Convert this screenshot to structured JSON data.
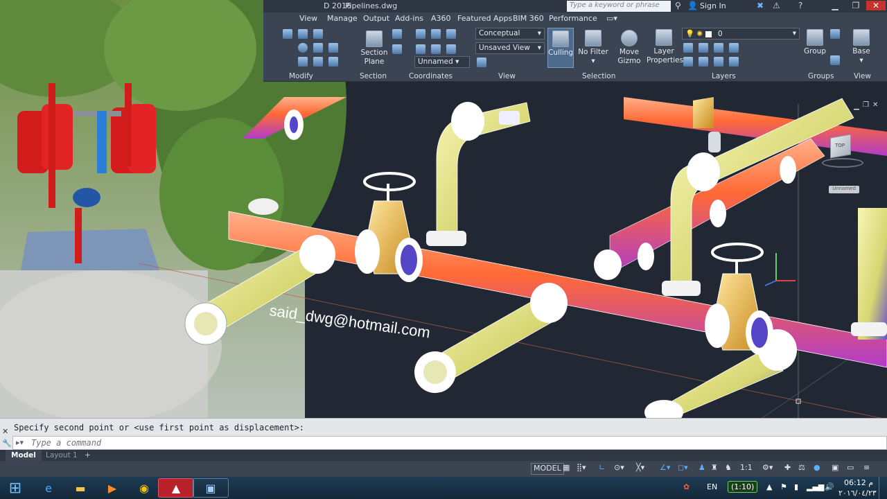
{
  "app": {
    "title_file": "Pipelines.dwg",
    "title_prefix": "D 2016",
    "search_placeholder": "Type a keyword or phrase",
    "sign_in": "Sign In"
  },
  "ribbon": {
    "tabs": [
      "View",
      "Manage",
      "Output",
      "Add-ins",
      "A360",
      "Featured Apps",
      "BIM 360",
      "Performance"
    ],
    "panels": {
      "modify": "Modify",
      "section": "Section",
      "coordinates": "Coordinates",
      "view": "View",
      "selection": "Selection",
      "layers": "Layers",
      "groups": "Groups",
      "view2": "View"
    },
    "buttons": {
      "section_plane_1": "Section",
      "section_plane_2": "Plane",
      "culling": "Culling",
      "no_filter": "No Filter",
      "move_gizmo_1": "Move",
      "move_gizmo_2": "Gizmo",
      "layer_props_1": "Layer",
      "layer_props_2": "Properties",
      "group": "Group",
      "base": "Base"
    },
    "visual_style": "Conceptual",
    "view_name": "Unsaved View",
    "ucs_name": "Unnamed",
    "layer_current": "0"
  },
  "viewport": {
    "watermark": "said_dwg@hotmail.com",
    "viewcube_top": "TOP",
    "ucs_label": "Unnamed"
  },
  "command": {
    "history": "Specify second point or <use first point as displacement>:",
    "placeholder": "Type a command"
  },
  "layout_tabs": {
    "model": "Model",
    "layout1": "Layout 1",
    "add": "+"
  },
  "statusbar": {
    "model": "MODEL",
    "scale": "1:1"
  },
  "taskbar": {
    "lang": "EN",
    "battery": "(1:10)",
    "time": "06:12 م",
    "date": "٢٠١٦/٠٤/٢٣"
  },
  "colors": {
    "ribbon_bg": "#3a4452",
    "viewport_bg": "#222833",
    "pipe_orange": "#ff6b3d",
    "pipe_yellow": "#e9e58f",
    "valve_gold": "#e7b84a"
  }
}
